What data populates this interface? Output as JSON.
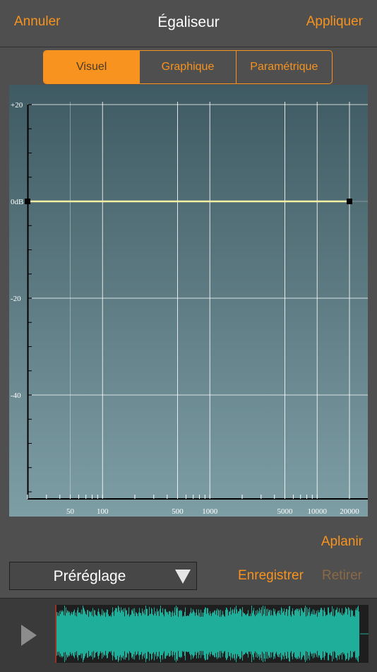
{
  "navbar": {
    "cancel_label": "Annuler",
    "title": "Égaliseur",
    "apply_label": "Appliquer"
  },
  "tabs": [
    {
      "label": "Visuel",
      "active": true
    },
    {
      "label": "Graphique",
      "active": false
    },
    {
      "label": "Paramétrique",
      "active": false
    }
  ],
  "eq_graph": {
    "y_labels": [
      "+20",
      "0dB",
      "-20",
      "-40"
    ],
    "x_labels": [
      "50",
      "100",
      "500",
      "1000",
      "5000",
      "10000",
      "20000"
    ],
    "y_range_db": [
      -60,
      24
    ],
    "x_range_hz": [
      20,
      20000
    ],
    "curve_db": 0,
    "handles_hz": [
      20,
      20000
    ],
    "colors": {
      "background_top": "#3f5a62",
      "background_bottom": "#7e9ea5",
      "curve": "#f3f0a4",
      "grid": "#ffffff"
    }
  },
  "actions": {
    "flatten_label": "Aplanir",
    "save_label": "Enregistrer",
    "remove_label": "Retirer"
  },
  "preset": {
    "label": "Préréglage"
  },
  "player": {
    "play_icon": "play-icon",
    "waveform_color": "#1fae9a"
  },
  "colors": {
    "accent": "#f7931e",
    "background": "#4f4f4f"
  }
}
